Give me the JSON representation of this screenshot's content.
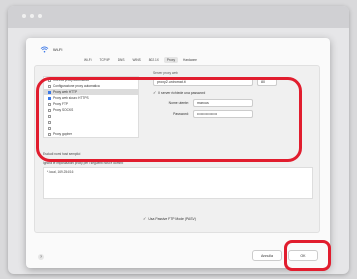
{
  "dialog": {
    "title": "Wi-Fi",
    "tabs": [
      "Wi-Fi",
      "TCP/IP",
      "DNS",
      "WINS",
      "802.1X",
      "Proxy",
      "Hardware"
    ],
    "active_tab": "Proxy"
  },
  "proxy": {
    "config_label": "",
    "protocols": [
      {
        "label": "RilevSa proxy automatico",
        "checked": false
      },
      {
        "label": "Configurazione proxy automatica",
        "checked": false
      },
      {
        "label": "Proxy web HTTP",
        "checked": true,
        "selected": true
      },
      {
        "label": "Proxy web sicuro HTTPS",
        "checked": true
      },
      {
        "label": "Proxy FTP",
        "checked": false
      },
      {
        "label": "Proxy SOCKS",
        "checked": false
      },
      {
        "label": "",
        "checked": false
      },
      {
        "label": "",
        "checked": false
      },
      {
        "label": "",
        "checked": false
      },
      {
        "label": "Proxy gopher",
        "checked": false
      }
    ],
    "server_label": "Server proxy web",
    "server_value": "proxy2.uniromat.it",
    "port_value": "80",
    "auth_label": "Il server richiede una password",
    "auth_checked": true,
    "username_label": "Nome utente:",
    "username_value": "marcus",
    "password_label": "Password:",
    "password_value": "••••••••••••••••",
    "bypass_label": "Escludi nomi host semplici",
    "exclusions_label": "Ignora le impostazioni proxy per i seguenti host e domini:",
    "exclusions_value": "*.local, 169.254/16",
    "passive_label": "Usa Passive FTP Mode (PASV)",
    "passive_checked": true
  },
  "footer": {
    "help": "?",
    "cancel": "Annulla",
    "ok": "OK"
  },
  "colors": {
    "highlight": "#e11d2e",
    "accent": "#3b78e7"
  }
}
